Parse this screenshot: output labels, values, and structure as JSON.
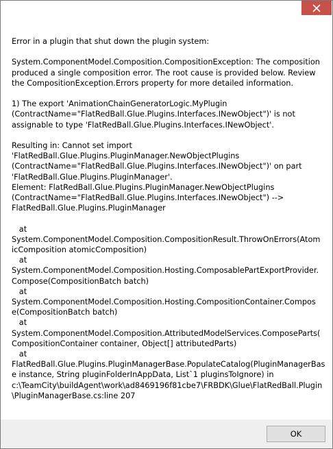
{
  "window": {
    "close_icon": "close-icon",
    "close_color": "#c7504a"
  },
  "message": {
    "paragraphs": [
      [
        "Error in a plugin that shut down the plugin system:"
      ],
      [
        "System.ComponentModel.Composition.CompositionException: The composition",
        "produced a single composition error. The root cause is provided below. Review",
        "the CompositionException.Errors property for more detailed information."
      ],
      [
        "1) The export 'AnimationChainGeneratorLogic.MyPlugin",
        "(ContractName=\"FlatRedBall.Glue.Plugins.Interfaces.INewObject\")' is not",
        "assignable to type 'FlatRedBall.Glue.Plugins.Interfaces.INewObject'."
      ],
      [
        "Resulting in: Cannot set import",
        "'FlatRedBall.Glue.Plugins.PluginManager.NewObjectPlugins",
        "(ContractName=\"FlatRedBall.Glue.Plugins.Interfaces.INewObject\")' on part",
        "'FlatRedBall.Glue.Plugins.PluginManager'.",
        "Element: FlatRedBall.Glue.Plugins.PluginManager.NewObjectPlugins",
        "(ContractName=\"FlatRedBall.Glue.Plugins.Interfaces.INewObject\") -->",
        "FlatRedBall.Glue.Plugins.PluginManager"
      ],
      [
        "   at",
        "System.ComponentModel.Composition.CompositionResult.ThrowOnErrors(Atom",
        "icComposition atomicComposition)",
        "   at",
        "System.ComponentModel.Composition.Hosting.ComposablePartExportProvider.",
        "Compose(CompositionBatch batch)",
        "   at",
        "System.ComponentModel.Composition.Hosting.CompositionContainer.Compos",
        "e(CompositionBatch batch)",
        "   at",
        "System.ComponentModel.Composition.AttributedModelServices.ComposeParts(",
        "CompositionContainer container, Object[] attributedParts)",
        "   at",
        "FlatRedBall.Glue.Plugins.PluginManagerBase.PopulateCatalog(PluginManagerBas",
        "e instance, String pluginFolderInAppData, List`1 pluginsToIgnore) in",
        "c:\\TeamCity\\buildAgent\\work\\ad8469196f81cbe7\\FRBDK\\Glue\\FlatRedBall.Plugin",
        "\\PluginManagerBase.cs:line 207"
      ]
    ]
  },
  "footer": {
    "ok_label": "OK"
  }
}
